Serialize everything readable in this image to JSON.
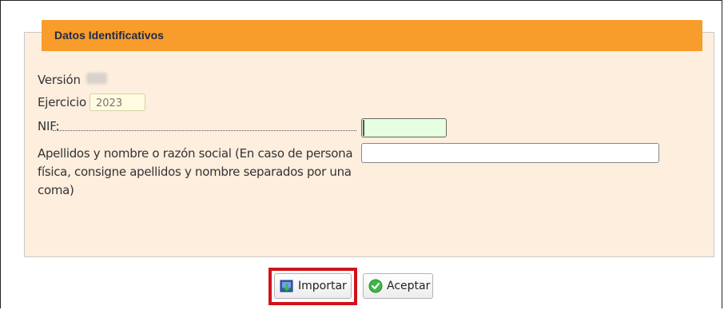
{
  "section": {
    "title": "Datos Identificativos"
  },
  "form": {
    "version_label": "Versión",
    "ejercicio_label": "Ejercicio",
    "ejercicio_value": "2023",
    "nif_label": "NIF:",
    "nif_value": "",
    "apellidos_label": "Apellidos y nombre o razón social (En caso de persona física, consigne apellidos y nombre separados por una coma)",
    "apellidos_value": ""
  },
  "buttons": {
    "importar_label": "Importar",
    "importar_icon": "import-icon",
    "aceptar_label": "Aceptar",
    "aceptar_icon": "check-circle-icon"
  },
  "colors": {
    "header": "#f89c2b",
    "panel": "#fdeede",
    "highlight": "#d0121b",
    "nif_field": "#e6ffe1"
  }
}
